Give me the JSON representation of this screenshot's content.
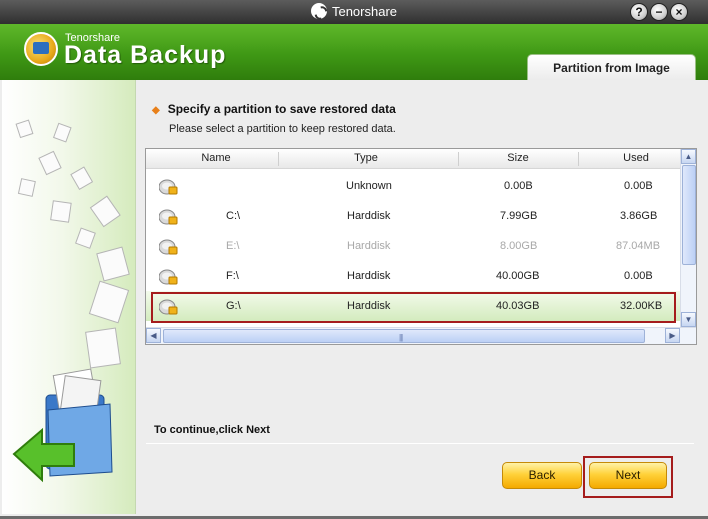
{
  "window": {
    "title": "Tenorshare",
    "buttons": [
      "?",
      "−",
      "×"
    ]
  },
  "header": {
    "brand_small": "Tenorshare",
    "brand_big": "Data Backup",
    "tab_active": "Partition from Image"
  },
  "step": {
    "title": "Specify a partition to save restored data",
    "subtitle": "Please select a partition to keep restored data."
  },
  "table": {
    "columns": [
      "Name",
      "Type",
      "Size",
      "Used"
    ],
    "rows": [
      {
        "name": "",
        "type": "Unknown",
        "size": "0.00B",
        "used": "0.00B",
        "enabled": true,
        "selected": false
      },
      {
        "name": "C:\\",
        "type": "Harddisk",
        "size": "7.99GB",
        "used": "3.86GB",
        "enabled": true,
        "selected": false
      },
      {
        "name": "E:\\",
        "type": "Harddisk",
        "size": "8.00GB",
        "used": "87.04MB",
        "enabled": false,
        "selected": false
      },
      {
        "name": "F:\\",
        "type": "Harddisk",
        "size": "40.00GB",
        "used": "0.00B",
        "enabled": true,
        "selected": false
      },
      {
        "name": "G:\\",
        "type": "Harddisk",
        "size": "40.03GB",
        "used": "32.00KB",
        "enabled": true,
        "selected": true
      }
    ]
  },
  "footer": {
    "continue_text": "To continue,click Next",
    "back_label": "Back",
    "next_label": "Next"
  },
  "icons": {
    "row_icon": "hard-disk-icon",
    "sidebar_art": "documents-into-folder-icon",
    "back_arrow": "green-arrow-left-icon"
  },
  "colors": {
    "header_green": "#3f9815",
    "button_yellow": "#ffd23a",
    "highlight_red": "#a51c1c",
    "selection_green": "#d3ebbe"
  }
}
